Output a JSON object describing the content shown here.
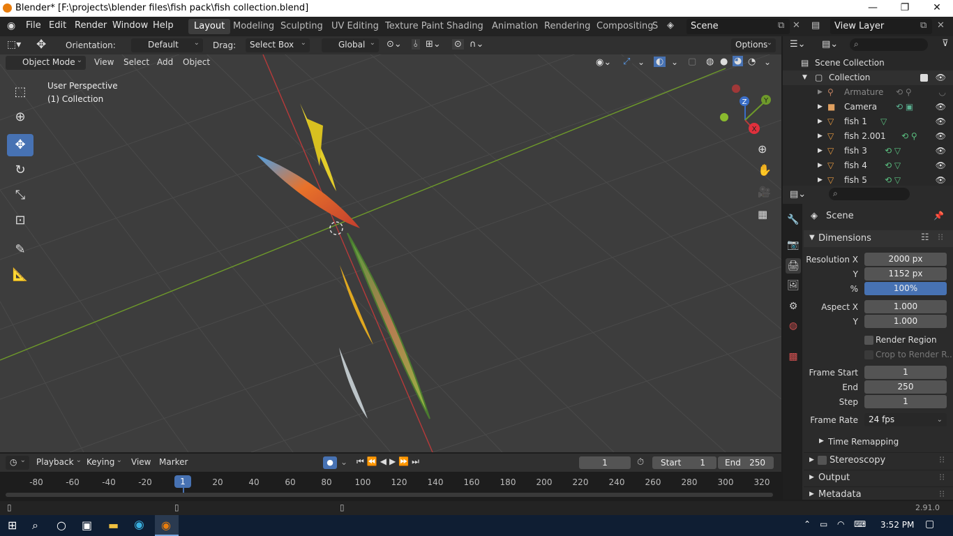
{
  "window": {
    "title": "Blender* [F:\\projects\\blender files\\fish pack\\fish collection.blend]",
    "minimize": "—",
    "maximize": "❐",
    "close": "✕"
  },
  "menu": [
    "File",
    "Edit",
    "Render",
    "Window",
    "Help"
  ],
  "workspaces": [
    "Layout",
    "Modeling",
    "Sculpting",
    "UV Editing",
    "Texture Paint",
    "Shading",
    "Animation",
    "Rendering",
    "Compositing",
    "S"
  ],
  "active_workspace": "Layout",
  "scene_selector": "Scene",
  "view_layer_selector": "View Layer",
  "tool_header": {
    "orientation_label": "Orientation:",
    "orientation_value": "Default",
    "drag_label": "Drag:",
    "drag_value": "Select Box",
    "transform_orientation": "Global",
    "options": "Options"
  },
  "viewport_header": {
    "mode": "Object Mode",
    "view": "View",
    "select": "Select",
    "add": "Add",
    "object": "Object"
  },
  "viewport": {
    "perspective": "User Perspective",
    "collection": "(1) Collection",
    "gizmo": {
      "x": "X",
      "y": "Y",
      "z": "Z"
    }
  },
  "outliner": {
    "root": "Scene Collection",
    "collection": "Collection",
    "items": [
      {
        "name": "Armature"
      },
      {
        "name": "Camera"
      },
      {
        "name": "fish 1"
      },
      {
        "name": "fish 2.001"
      },
      {
        "name": "fish 3"
      },
      {
        "name": "fish 4"
      },
      {
        "name": "fish 5"
      }
    ]
  },
  "properties": {
    "context": "Scene",
    "dimensions": "Dimensions",
    "resolution_x_label": "Resolution X",
    "resolution_x": "2000 px",
    "resolution_y_label": "Y",
    "resolution_y": "1152 px",
    "percent_label": "%",
    "percent": "100%",
    "aspect_x_label": "Aspect X",
    "aspect_x": "1.000",
    "aspect_y_label": "Y",
    "aspect_y": "1.000",
    "render_region": "Render Region",
    "crop_region": "Crop to Render R...",
    "frame_start_label": "Frame Start",
    "frame_start": "1",
    "end_label": "End",
    "end": "250",
    "step_label": "Step",
    "step": "1",
    "frame_rate_label": "Frame Rate",
    "frame_rate": "24 fps",
    "time_remapping": "Time Remapping",
    "stereoscopy": "Stereoscopy",
    "output": "Output",
    "metadata": "Metadata"
  },
  "timeline": {
    "playback": "Playback",
    "keying": "Keying",
    "view": "View",
    "marker": "Marker",
    "current_frame": "1",
    "start_label": "Start",
    "start": "1",
    "end_label": "End",
    "end": "250",
    "ticks": [
      "-80",
      "-60",
      "-40",
      "-20",
      "1",
      "20",
      "40",
      "60",
      "80",
      "100",
      "120",
      "140",
      "160",
      "180",
      "200",
      "220",
      "240",
      "260",
      "280",
      "300",
      "320"
    ]
  },
  "status": {
    "version": "2.91.0"
  },
  "taskbar": {
    "time": "3:52 PM"
  }
}
